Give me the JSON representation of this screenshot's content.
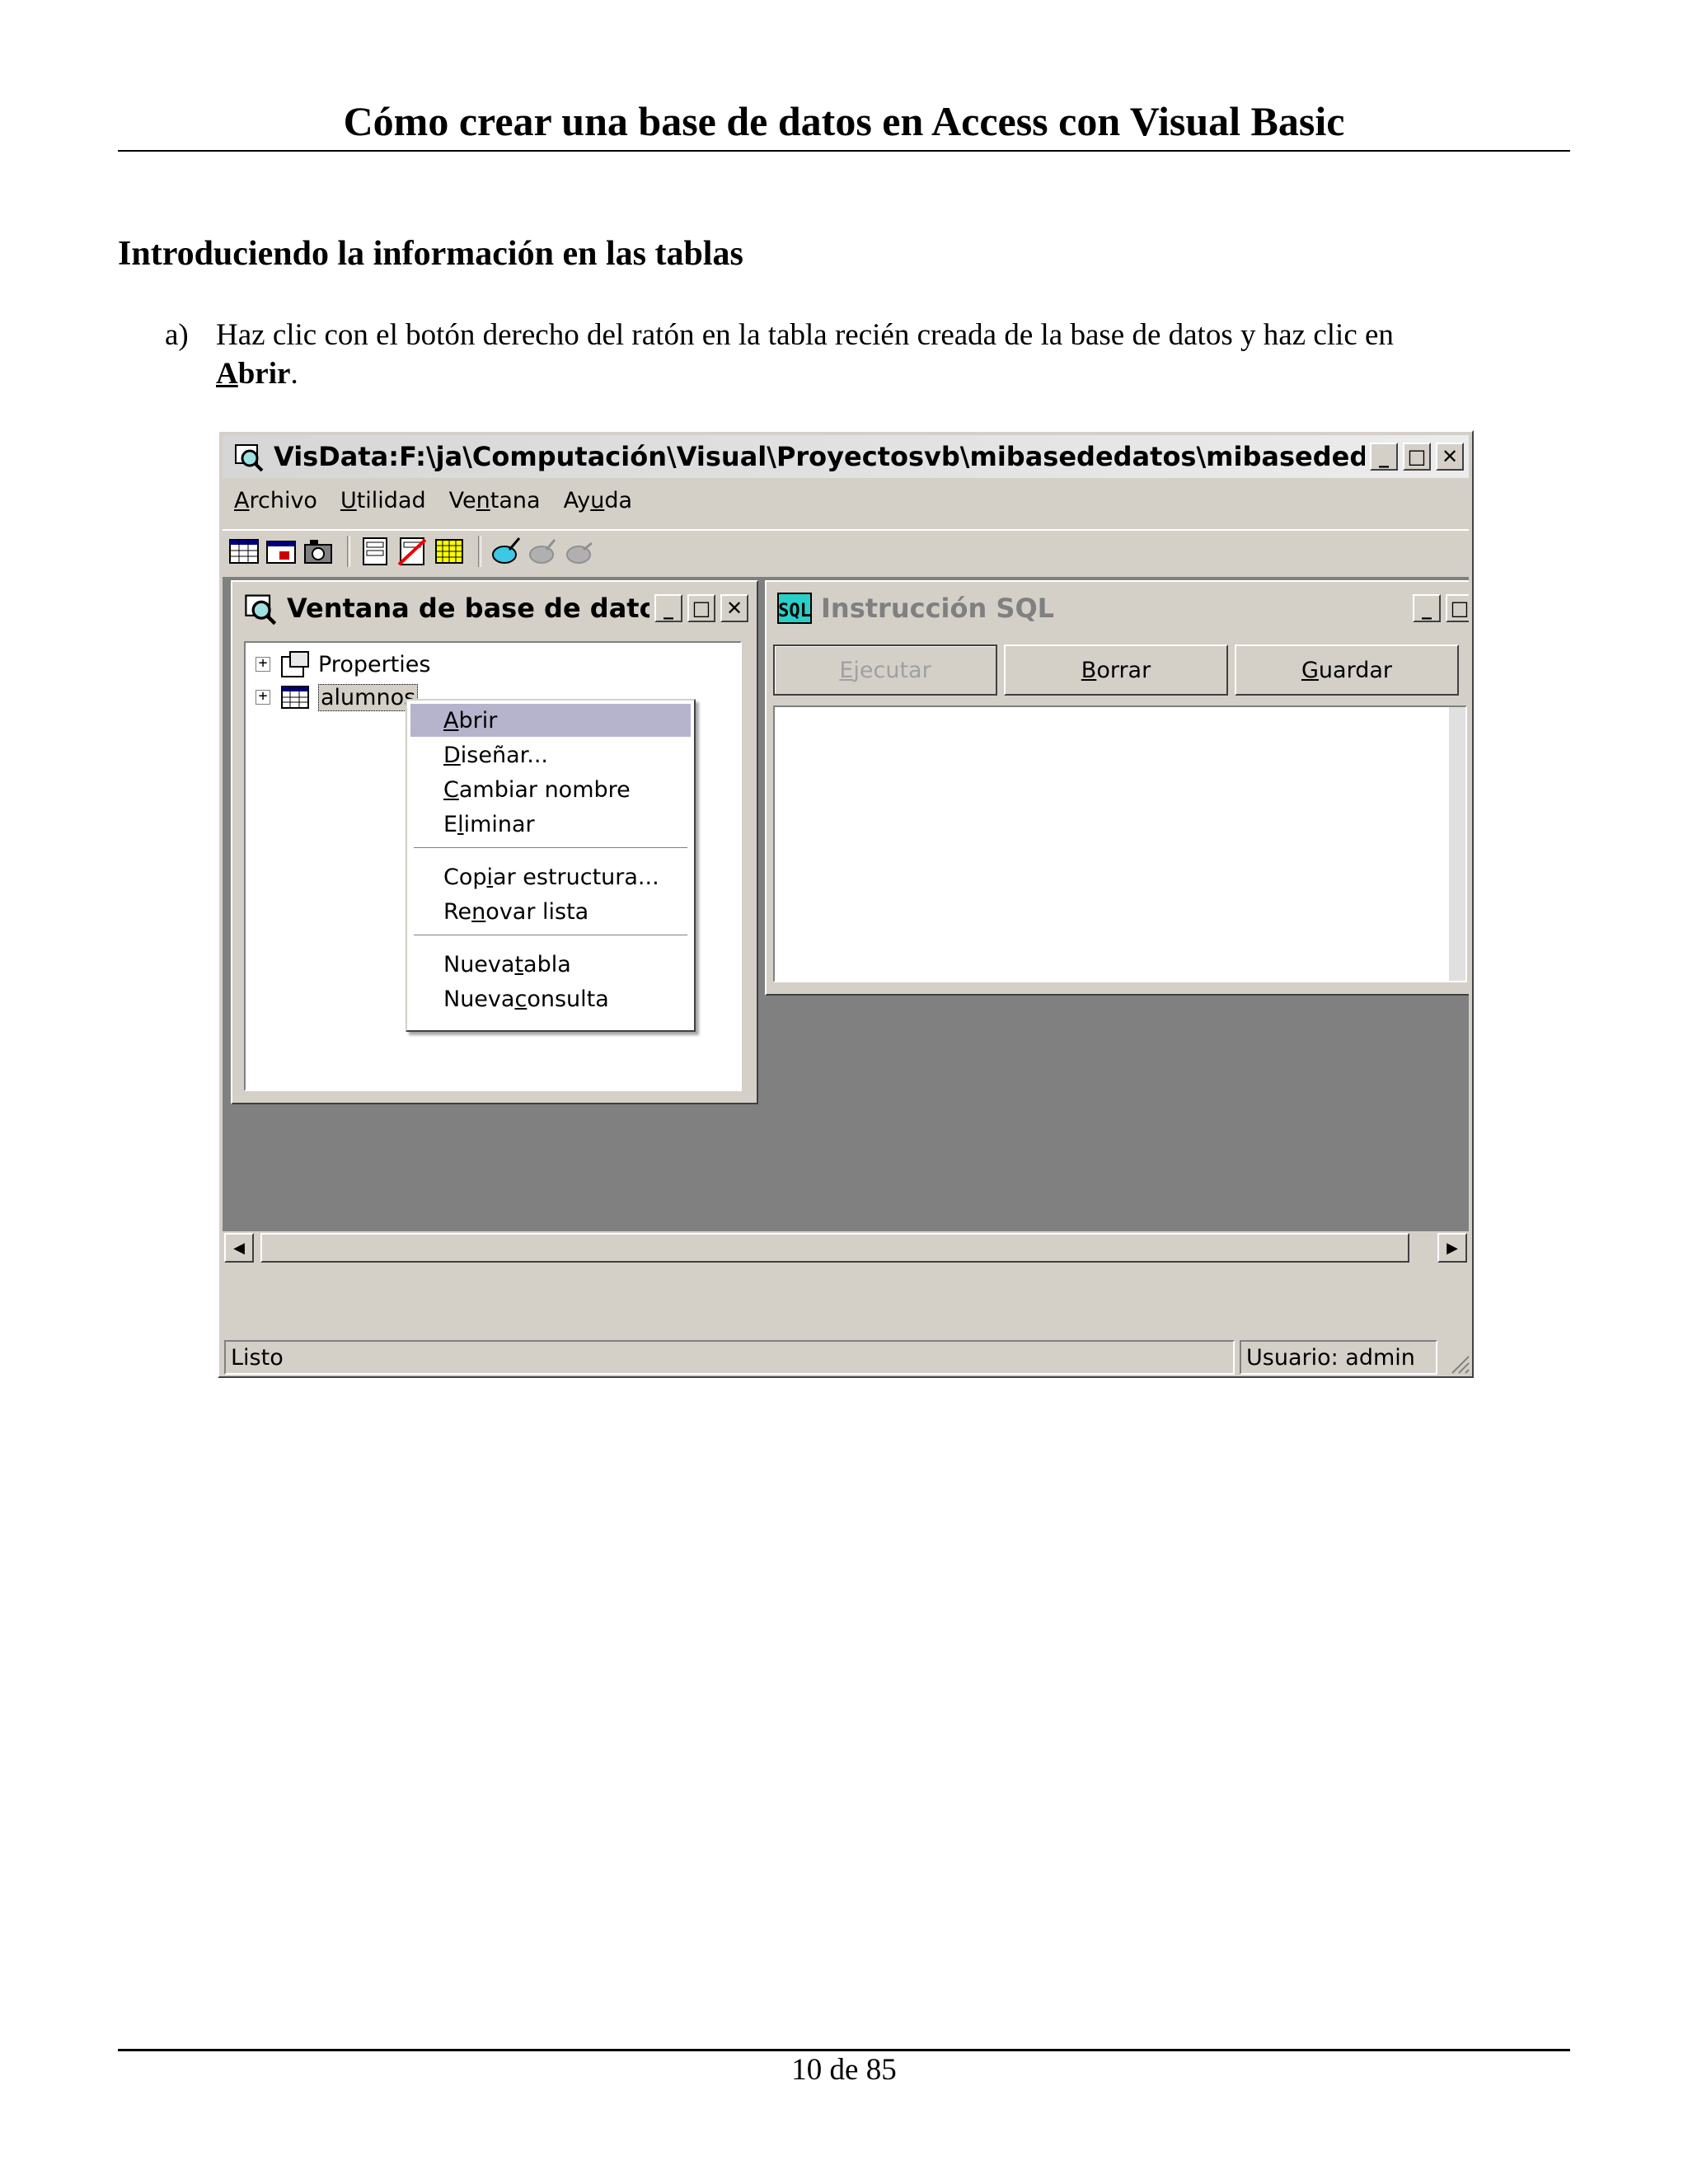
{
  "page": {
    "header": "Cómo crear una base de datos en Access con Visual Basic",
    "section_title": "Introduciendo la información en las tablas",
    "step": {
      "marker": "a)",
      "text": "Haz clic con el botón derecho del ratón en la tabla recién creada de la base de datos y haz clic en",
      "emph_first": "A",
      "emph_rest": "brir",
      "end": "."
    },
    "page_number": "10 de 85"
  },
  "window": {
    "title": "VisData:F:\\ja\\Computación\\Visual\\Proyectosvb\\mibasededatos\\mibasededatos.mdb",
    "caption_buttons": [
      "_",
      "□",
      "✕"
    ],
    "menus": [
      {
        "first": "A",
        "rest": "rchivo"
      },
      {
        "first": "U",
        "rest": "tilidad"
      },
      {
        "pre": "Ve",
        "first": "n",
        "rest": "tana"
      },
      {
        "pre": "Ay",
        "first": "u",
        "rest": "da"
      }
    ],
    "db_window": {
      "title": "Ventana de base de datos",
      "tree": [
        "Properties",
        "alumnos"
      ]
    },
    "sql_window": {
      "title": "Instrucción SQL",
      "buttons": [
        {
          "first": "E",
          "rest": "jecutar"
        },
        {
          "first": "B",
          "rest": "orrar"
        },
        {
          "first": "G",
          "rest": "uardar"
        }
      ]
    },
    "context_menu": {
      "items": [
        {
          "first": "A",
          "rest": "brir"
        },
        {
          "first": "D",
          "rest": "iseñar..."
        },
        {
          "first": "C",
          "rest": "ambiar nombre"
        },
        {
          "pre": "E",
          "first": "l",
          "rest": "iminar"
        },
        {
          "pre": "Cop",
          "first": "i",
          "rest": "ar estructura..."
        },
        {
          "pre": "Re",
          "first": "n",
          "rest": "ovar lista"
        },
        {
          "pre": "Nueva ",
          "first": "t",
          "rest": "abla"
        },
        {
          "pre": "Nueva ",
          "first": "c",
          "rest": "onsulta"
        }
      ]
    },
    "status": {
      "main": "Listo",
      "user": "Usuario: admin"
    },
    "colors": {
      "face": "#d4d0c8",
      "menu_highlight": "#b6b4cc",
      "mdi_background": "#808080"
    },
    "icons": [
      "database-search-icon",
      "table-grid-icon",
      "sql-icon",
      "properties-icon"
    ]
  }
}
